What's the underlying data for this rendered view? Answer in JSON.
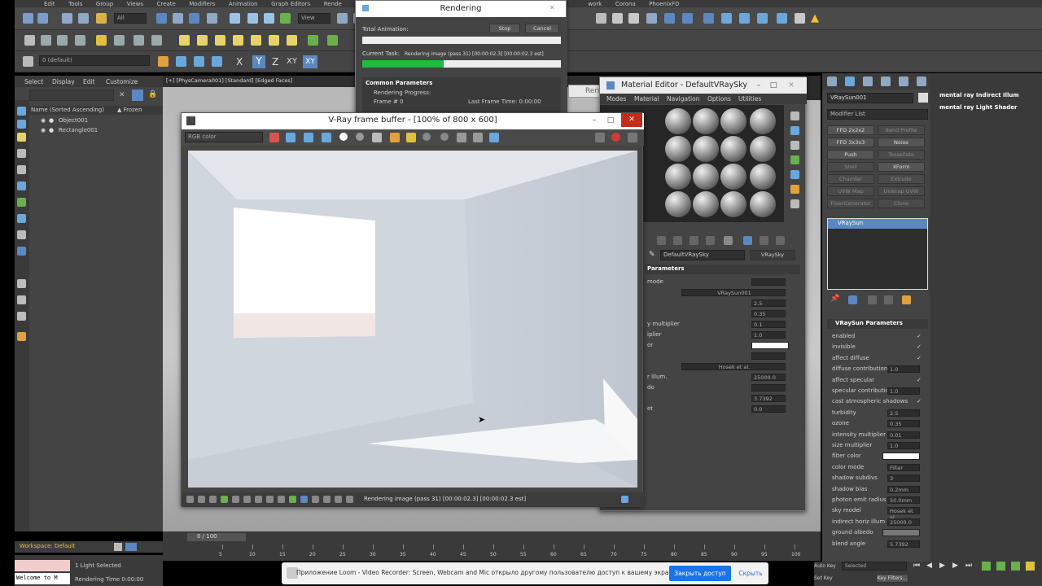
{
  "menu": [
    "Edit",
    "Tools",
    "Group",
    "Views",
    "Create",
    "Modifiers",
    "Animation",
    "Graph Editors",
    "Rende",
    "work",
    "Corona",
    "PhoenixFD"
  ],
  "toolbar": {
    "selection_set": "0 (default)",
    "view_dropdown": "View",
    "all_filter": "All"
  },
  "axis_buttons": [
    "X",
    "Y",
    "Z",
    "XY",
    "XY"
  ],
  "scene_explorer": {
    "tabs": [
      "Select",
      "Display",
      "Edit",
      "Customize"
    ],
    "column_name": "Name (Sorted Ascending)",
    "column_frozen": "▲ Frozen",
    "items": [
      "Object001",
      "Rectangle001"
    ]
  },
  "viewport": {
    "label": "[+] [PhysCamera001] [Standard] [Edged Faces]"
  },
  "rendering_window": {
    "title": "Rendering",
    "total_animation": "Total Animation:",
    "current_task_label": "Current Task:",
    "current_task_value": "Rendering image (pass 31) [00:00:02.3] [00:00:02.3 est]",
    "stop": "Stop",
    "cancel": "Cancel",
    "progress": 0.41,
    "common_params": "Common Parameters",
    "rendering_progress": "Rendering Progress:",
    "frame_label": "Frame #",
    "frame_value": "0",
    "last_frame_time": "Last Frame Time: 0:00:00"
  },
  "behind_label": "Ren",
  "vfb": {
    "title": "V-Ray frame buffer - [100% of 800 x 600]",
    "channel": "RGB color",
    "status": "Rendering image (pass 31) [00:00:02.3] [00:00:02.3 est]"
  },
  "material_editor": {
    "title": "Material Editor - DefaultVRaySky",
    "menu": [
      "Modes",
      "Material",
      "Navigation",
      "Options",
      "Utilities"
    ],
    "material_name": "DefaultVRaySky",
    "material_type": "VRaySky",
    "rollout": "Parameters",
    "rows": [
      {
        "label": "mode",
        "value": ""
      },
      {
        "label": "",
        "value": "VRaySun001"
      },
      {
        "label": "",
        "value": "2.5"
      },
      {
        "label": "",
        "value": "0.35"
      },
      {
        "label": "y multiplier",
        "value": "0.1"
      },
      {
        "label": "iplier",
        "value": "1.0"
      },
      {
        "label": "or",
        "value": ""
      },
      {
        "label": "",
        "value": ""
      },
      {
        "label": "",
        "value": "Hosek et al."
      },
      {
        "label": "r illum.",
        "value": "25000.0"
      },
      {
        "label": "do",
        "value": ""
      },
      {
        "label": "",
        "value": "3.7392"
      },
      {
        "label": "et",
        "value": "0.0"
      }
    ]
  },
  "command_panel": {
    "object_name": "VRaySun001",
    "modifier_list": "Modifier List",
    "modifier_buttons": [
      "FFD 2x2x2",
      "Bend Profile",
      "FFD 3x3x3",
      "Noise",
      "Push",
      "Tessellate",
      "Shell",
      "XForm",
      "Chamfer",
      "Extrude",
      "UVW Map",
      "Unwrap UVW",
      "FloorGenerator",
      "Clone"
    ],
    "stack_item": "VRaySun",
    "params_title": "VRaySun Parameters",
    "params": [
      {
        "label": "enabled",
        "value": "",
        "check": true
      },
      {
        "label": "invisible",
        "value": "",
        "check": true
      },
      {
        "label": "affect diffuse",
        "value": "",
        "check": true
      },
      {
        "label": "diffuse contribution",
        "value": "1.0",
        "check": false
      },
      {
        "label": "affect specular",
        "value": "",
        "check": true
      },
      {
        "label": "specular contributio",
        "value": "1.0",
        "check": false
      },
      {
        "label": "cast atmospheric shadows",
        "value": "",
        "check": true
      },
      {
        "label": "turbidity",
        "value": "2.5",
        "check": false
      },
      {
        "label": "ozone",
        "value": "0.35",
        "check": false
      },
      {
        "label": "intensity multiplier",
        "value": "0.01",
        "check": false
      },
      {
        "label": "size multiplier",
        "value": "1.0",
        "check": false
      },
      {
        "label": "filter color",
        "value": "",
        "check": false
      },
      {
        "label": "color mode",
        "value": "Filter",
        "check": false
      },
      {
        "label": "shadow subdivs",
        "value": "3",
        "check": false
      },
      {
        "label": "shadow bias",
        "value": "0.2mm",
        "check": false
      },
      {
        "label": "photon emit radius",
        "value": "50.0mm",
        "check": false
      },
      {
        "label": "sky model",
        "value": "Hosek et al.",
        "check": false
      },
      {
        "label": "indirect horiz illum",
        "value": "25000.0",
        "check": false
      },
      {
        "label": "ground albedo",
        "value": "",
        "check": false
      },
      {
        "label": "blend angle",
        "value": "5.7392",
        "check": false
      }
    ]
  },
  "far_right": [
    "mental ray Indirect Illum",
    "mental ray Light Shader"
  ],
  "timeline": {
    "frame": "0 / 100",
    "ticks": [
      "5",
      "10",
      "15",
      "20",
      "25",
      "30",
      "35",
      "40",
      "45",
      "50",
      "55",
      "60",
      "65",
      "70",
      "75",
      "80",
      "85",
      "90",
      "95",
      "100"
    ]
  },
  "workspace": "Workspace: Default",
  "status": {
    "selected": "1 Light Selected",
    "render_time": "Rendering Time 0:00:00",
    "maxscript": "Welcome to M"
  },
  "loom": {
    "message": "Приложение Loom - Video Recorder: Screen, Webcam and Mic открыло другому пользователю доступ к вашему экрану",
    "primary": "Закрыть доступ",
    "secondary": "Скрыть"
  },
  "bottom_right": {
    "auto_key": "Auto Key",
    "set_key": "Set Key",
    "selected": "Selected",
    "key_filters": "Key Filters..."
  }
}
